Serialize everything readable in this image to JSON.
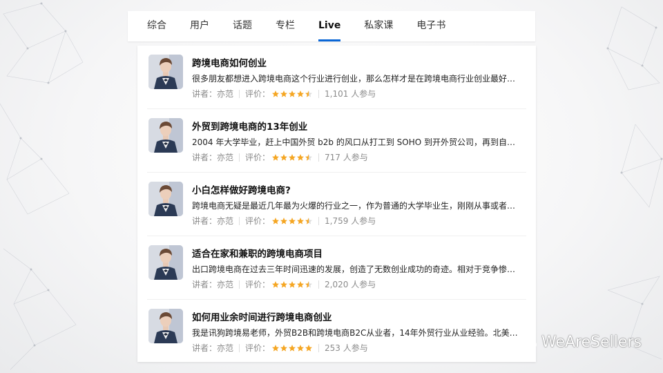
{
  "tabs": [
    {
      "label": "综合",
      "active": false
    },
    {
      "label": "用户",
      "active": false
    },
    {
      "label": "话题",
      "active": false
    },
    {
      "label": "专栏",
      "active": false
    },
    {
      "label": "Live",
      "active": true
    },
    {
      "label": "私家课",
      "active": false
    },
    {
      "label": "电子书",
      "active": false
    }
  ],
  "items": [
    {
      "title": "跨境电商如何创业",
      "desc": "很多朋友都想进入跨境电商这个行业进行创业，那么怎样才是在跨境电商行业创业最好的方...",
      "speaker": "讲者：亦范",
      "rating_label": "评价：",
      "rating": 4.5,
      "participants": "1,101 人参与"
    },
    {
      "title": "外贸到跨境电商的13年创业",
      "desc": "2004 年大学毕业，赶上中国外贸 b2b 的风口从打工到 SOHO 到开外贸公司，再到自己的...",
      "speaker": "讲者：亦范",
      "rating_label": "评价：",
      "rating": 4.5,
      "participants": "717 人参与"
    },
    {
      "title": "小白怎样做好跨境电商?",
      "desc": "跨境电商无疑是最近几年最为火爆的行业之一，作为普通的大学毕业生，刚刚从事或者有志...",
      "speaker": "讲者：亦范",
      "rating_label": "评价：",
      "rating": 4.5,
      "participants": "1,759 人参与"
    },
    {
      "title": "适合在家和兼职的跨境电商项目",
      "desc": "出口跨境电商在过去三年时间迅速的发展，创造了无数创业成功的奇迹。相对于竞争惨烈的...",
      "speaker": "讲者：亦范",
      "rating_label": "评价：",
      "rating": 4.5,
      "participants": "2,020 人参与"
    },
    {
      "title": "如何用业余时间进行跨境电商创业",
      "desc": "我是讯狗跨境易老师，外贸B2B和跨境电商B2C从业者，14年外贸行业从业经验。北美领先...",
      "speaker": "讲者：亦范",
      "rating_label": "评价：",
      "rating": 5,
      "participants": "253 人参与"
    }
  ],
  "colors": {
    "accent": "#0a66d6",
    "star": "#f5a623",
    "star_empty": "#dcdcdc"
  },
  "watermark": {
    "text": "WeAreSellers",
    "icon": "wechat-icon"
  }
}
